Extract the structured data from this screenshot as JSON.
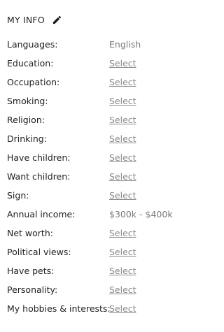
{
  "section": {
    "title": "MY INFO",
    "edit_icon": "pencil-icon"
  },
  "rows": [
    {
      "label": "Languages:",
      "value": "English",
      "is_link": false
    },
    {
      "label": "Education:",
      "value": "Select",
      "is_link": true
    },
    {
      "label": "Occupation:",
      "value": "Select",
      "is_link": true
    },
    {
      "label": "Smoking:",
      "value": "Select",
      "is_link": true
    },
    {
      "label": "Religion:",
      "value": "Select",
      "is_link": true
    },
    {
      "label": "Drinking:",
      "value": "Select",
      "is_link": true
    },
    {
      "label": "Have children:",
      "value": "Select",
      "is_link": true
    },
    {
      "label": "Want children:",
      "value": "Select",
      "is_link": true
    },
    {
      "label": "Sign:",
      "value": "Select",
      "is_link": true
    },
    {
      "label": "Annual income:",
      "value": "$300k - $400k",
      "is_link": false
    },
    {
      "label": "Net worth:",
      "value": "Select",
      "is_link": true
    },
    {
      "label": "Political views:",
      "value": "Select",
      "is_link": true
    },
    {
      "label": "Have pets:",
      "value": "Select",
      "is_link": true
    },
    {
      "label": "Personality:",
      "value": "Select",
      "is_link": true
    },
    {
      "label": "My hobbies & interests:",
      "value": "Select",
      "is_link": true
    }
  ],
  "colors": {
    "text": "#222222",
    "value_text": "#7a7a7a",
    "link_text": "#8a8a8a",
    "background": "#ffffff"
  }
}
